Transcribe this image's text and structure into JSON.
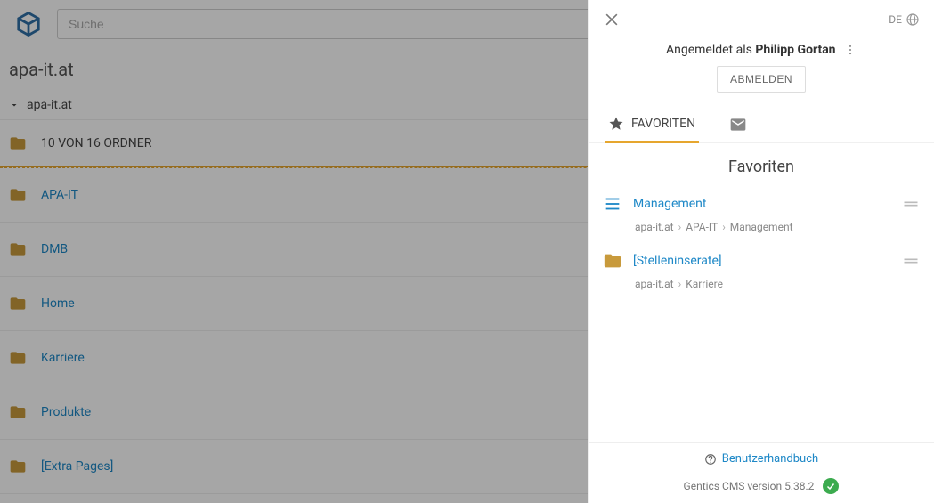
{
  "search": {
    "placeholder": "Suche"
  },
  "page_title": "apa-it.at",
  "tree_root": "apa-it.at",
  "section_header": "10 VON 16 ORDNER",
  "folders": [
    {
      "name": "APA-IT"
    },
    {
      "name": "DMB"
    },
    {
      "name": "Home"
    },
    {
      "name": "Karriere"
    },
    {
      "name": "Produkte"
    },
    {
      "name": "[Extra Pages]"
    }
  ],
  "panel": {
    "lang": "DE",
    "logged_in_prefix": "Angemeldet als ",
    "logged_in_name": "Philipp Gortan",
    "logout": "ABMELDEN",
    "tabs": {
      "fav_label": "FAVORITEN"
    },
    "fav_heading": "Favoriten",
    "favorites": [
      {
        "type": "page",
        "name": "Management",
        "crumbs": [
          "apa-it.at",
          "APA-IT",
          "Management"
        ]
      },
      {
        "type": "folder",
        "name": "[Stelleninserate]",
        "crumbs": [
          "apa-it.at",
          "Karriere"
        ]
      }
    ],
    "help_label": "Benutzerhandbuch",
    "version": "Gentics CMS version 5.38.2"
  }
}
